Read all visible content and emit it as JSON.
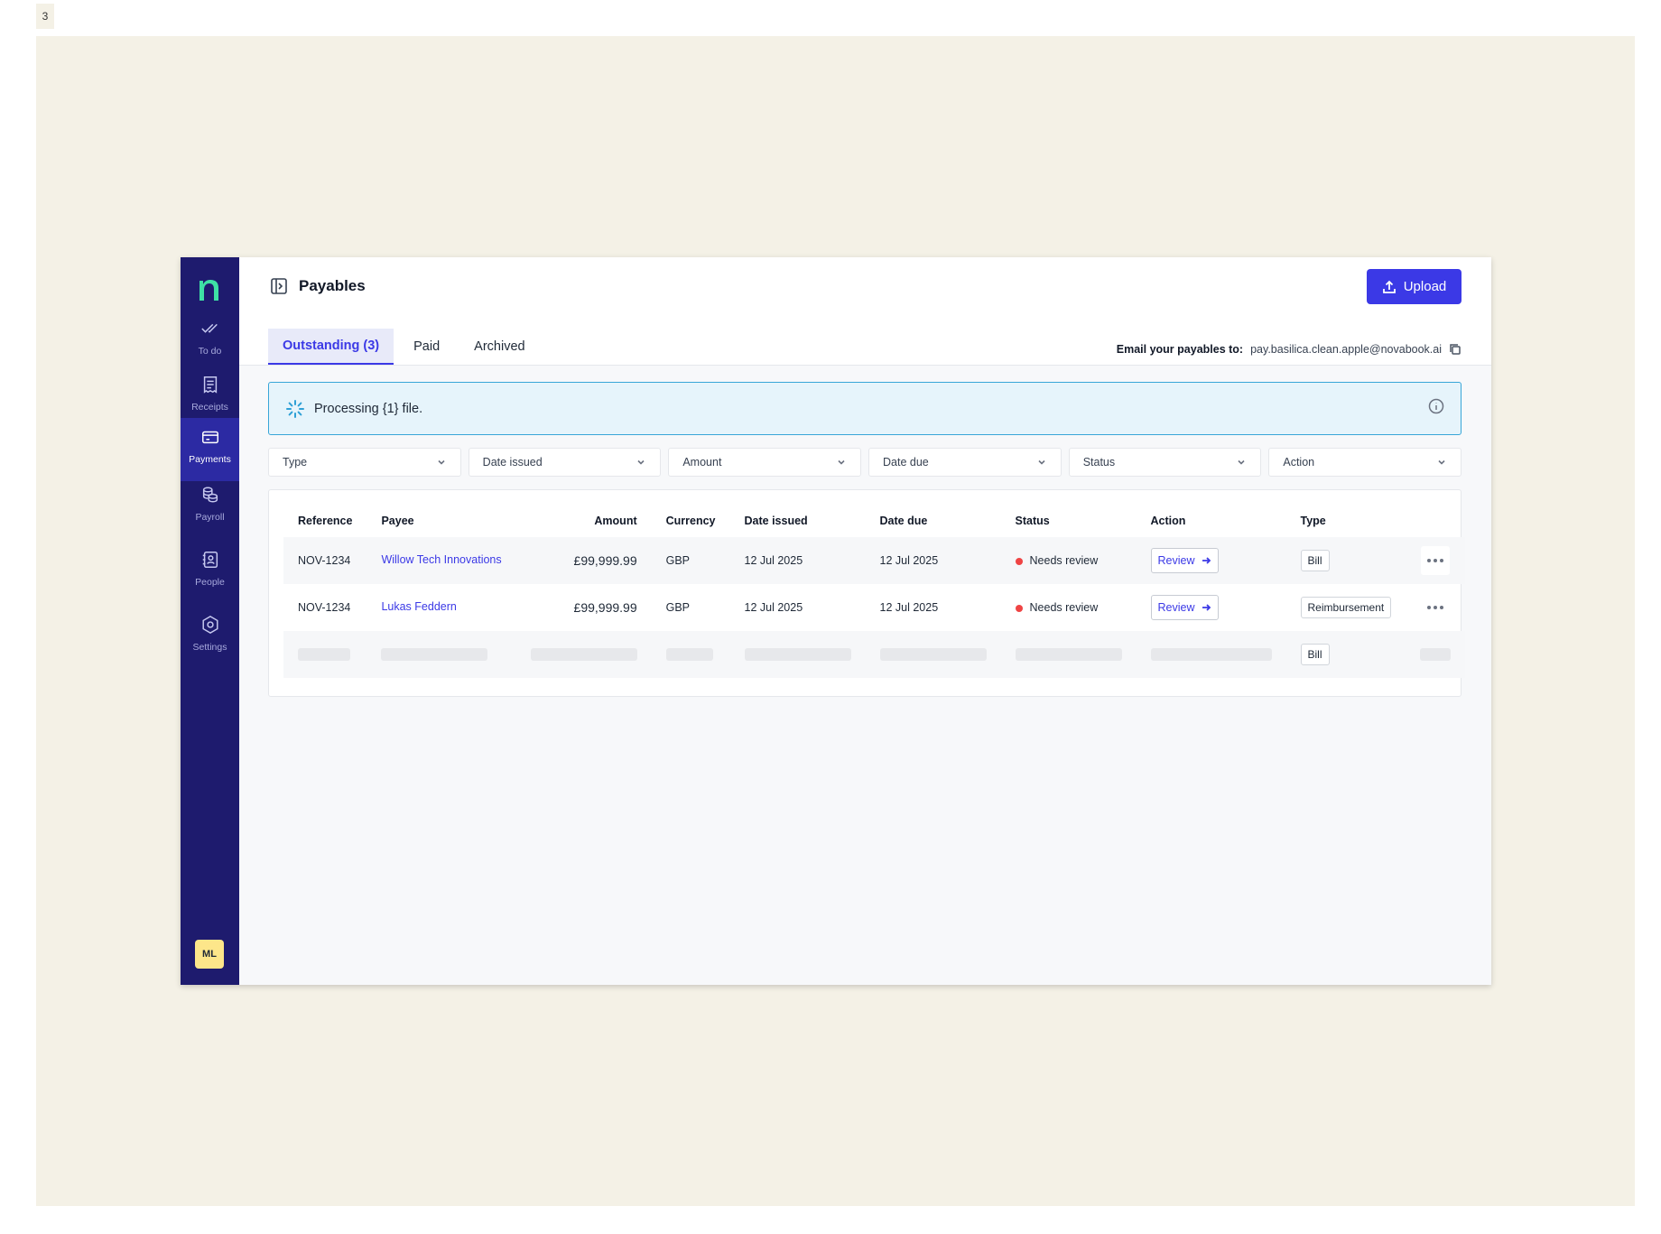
{
  "frame": {
    "label": "3"
  },
  "sidebar": {
    "logo": "novabook-logo",
    "items": [
      {
        "label": "To do",
        "icon": "double-check-icon",
        "active": false
      },
      {
        "label": "Receipts",
        "icon": "receipt-icon",
        "active": false
      },
      {
        "label": "Payments",
        "icon": "card-icon",
        "active": true
      },
      {
        "label": "Payroll",
        "icon": "coins-icon",
        "active": false
      },
      {
        "label": "People",
        "icon": "contact-book-icon",
        "active": false
      },
      {
        "label": "Settings",
        "icon": "gear-icon",
        "active": false
      }
    ],
    "avatar": "ML"
  },
  "header": {
    "title": "Payables",
    "upload_label": "Upload"
  },
  "tabs": [
    {
      "label": "Outstanding (3)",
      "active": true
    },
    {
      "label": "Paid",
      "active": false
    },
    {
      "label": "Archived",
      "active": false
    }
  ],
  "email": {
    "label": "Email your payables to:",
    "address": "pay.basilica.clean.apple@novabook.ai"
  },
  "banner": {
    "text": "Processing {1} file."
  },
  "filters": [
    "Type",
    "Date issued",
    "Amount",
    "Date due",
    "Status",
    "Action"
  ],
  "table": {
    "columns": [
      "Reference",
      "Payee",
      "Amount",
      "Currency",
      "Date issued",
      "Date due",
      "Status",
      "Action",
      "Type"
    ],
    "rows": [
      {
        "reference": "NOV-1234",
        "payee": "Willow Tech Innovations",
        "amount": "£99,999.99",
        "currency": "GBP",
        "date_issued": "12 Jul 2025",
        "date_due": "12 Jul 2025",
        "status": "Needs review",
        "action": "Review",
        "type": "Bill"
      },
      {
        "reference": "NOV-1234",
        "payee": "Lukas Feddern",
        "amount": "£99,999.99",
        "currency": "GBP",
        "date_issued": "12 Jul 2025",
        "date_due": "12 Jul 2025",
        "status": "Needs review",
        "action": "Review",
        "type": "Reimbursement"
      }
    ],
    "loading_row": {
      "type": "Bill"
    }
  },
  "colors": {
    "sidebar_bg": "#1e1b6e",
    "accent": "#3b39e6",
    "status_needs_review": "#ef4444",
    "banner_bg": "#e6f4fb",
    "canvas_bg": "#f4f1e6"
  }
}
